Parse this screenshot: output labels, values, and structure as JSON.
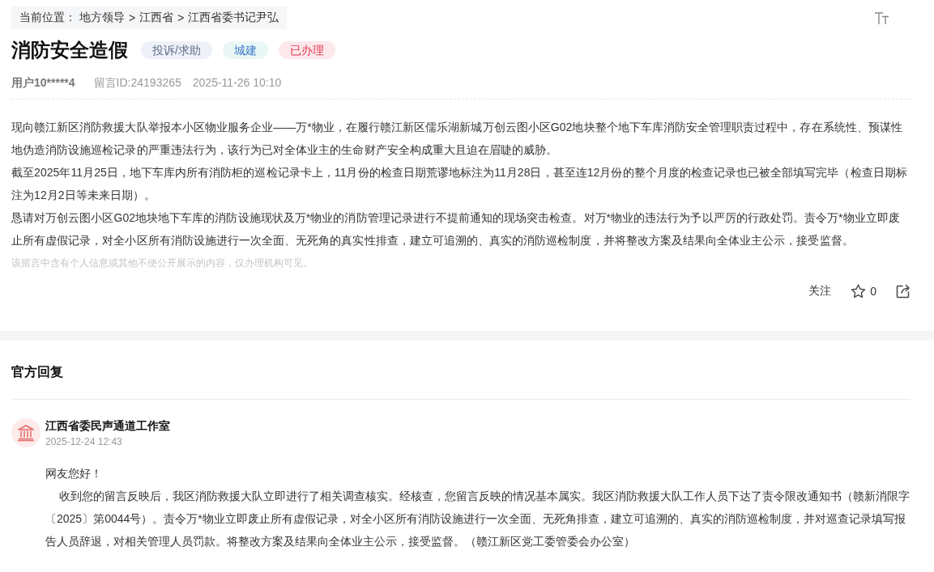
{
  "breadcrumb": {
    "prefix": "当前位置：",
    "items": [
      "地方领导",
      "江西省",
      "江西省委书记尹弘"
    ],
    "separators": [
      ">",
      ">"
    ]
  },
  "title": "消防安全造假",
  "tags": [
    {
      "label": "投诉/求助",
      "kind": "type"
    },
    {
      "label": "城建",
      "kind": "category"
    },
    {
      "label": "已办理",
      "kind": "status"
    }
  ],
  "meta": {
    "user": "用户10*****4",
    "message_id": "留言ID:24193265",
    "time": "2025-11-26 10:10"
  },
  "message": {
    "paragraphs": [
      "现向赣江新区消防救援大队举报本小区物业服务企业——万*物业，在履行赣江新区儒乐湖新城万创云图小区G02地块整个地下车库消防安全管理职责过程中，存在系统性、预谋性地伪造消防设施巡检记录的严重违法行为，该行为已对全体业主的生命财产安全构成重大且迫在眉睫的威胁。",
      "截至2025年11月25日，地下车库内所有消防柜的巡检记录卡上，11月份的检查日期荒谬地标注为11月28日，甚至连12月份的整个月度的检查记录也已被全部填写完毕（检查日期标注为12月2日等未来日期）。",
      "恳请对万创云图小区G02地块地下车库的消防设施现状及万*物业的消防管理记录进行不提前通知的现场突击检查。对万*物业的违法行为予以严厉的行政处罚。责令万*物业立即废止所有虚假记录，对全小区所有消防设施进行一次全面、无死角的真实性排查，建立可追溯的、真实的消防巡检制度，并将整改方案及结果向全体业主公示，接受监督。"
    ],
    "notice": "该留言中含有个人信息或其他不便公开展示的内容，仅办理机构可见。"
  },
  "actions": {
    "follow": "关注",
    "likes": "0"
  },
  "reply": {
    "title": "官方回复",
    "author": "江西省委民声通道工作室",
    "time": "2025-12-24 12:43",
    "greeting": "网友您好！",
    "paragraphs": [
      "收到您的留言反映后，我区消防救援大队立即进行了相关调查核实。经核查，您留言反映的情况基本属实。我区消防救援大队工作人员下达了责令限改通知书（赣新消限字〔2025〕第0044号）。责令万*物业立即废止所有虚假记录，对全小区所有消防设施进行一次全面、无死角排查，建立可追溯的、真实的消防巡检制度，并对巡查记录填写报告人员辞退，对相关管理人员罚款。将整改方案及结果向全体业主公示，接受监督。（赣江新区党工委管委会办公室）"
    ]
  }
}
